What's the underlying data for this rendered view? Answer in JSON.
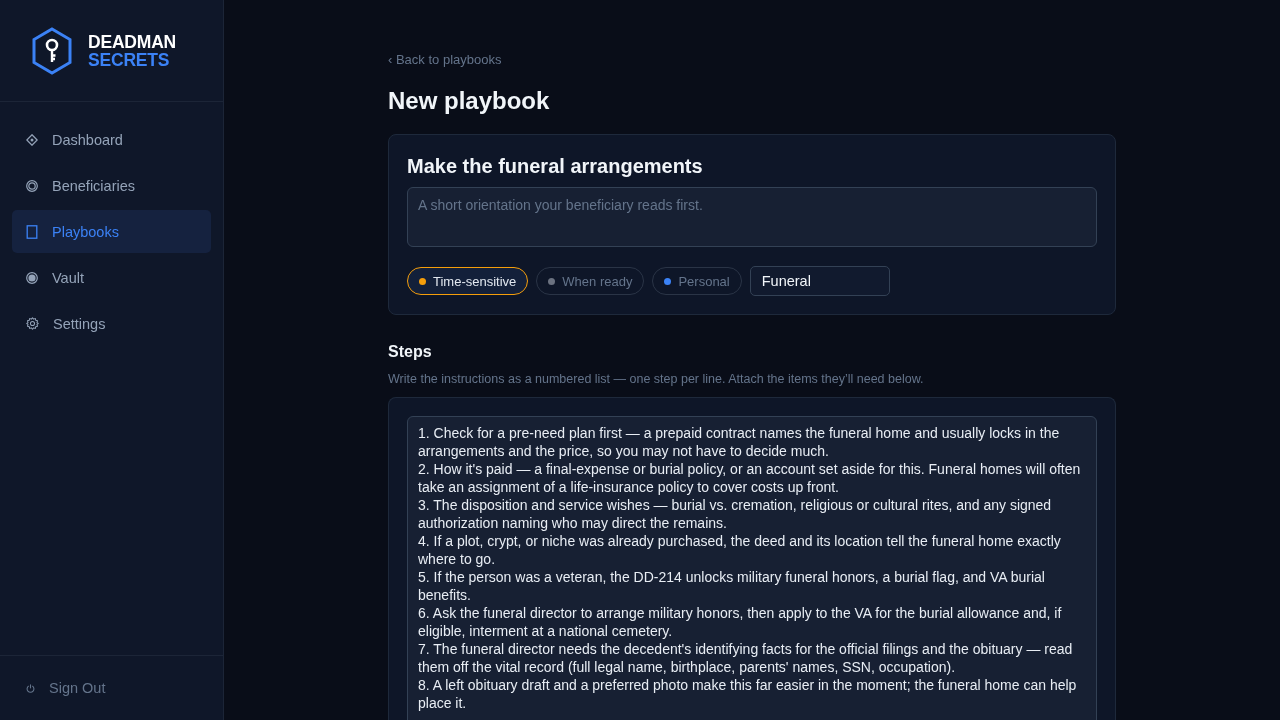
{
  "sidebar": {
    "logo": {
      "line_1": "DEADMAN",
      "line_2": "SECRETS"
    },
    "nav_items": [
      {
        "kind": "dashboard",
        "label": "Dashboard",
        "selected": false
      },
      {
        "kind": "beneficiaries",
        "label": "Beneficiaries",
        "selected": false
      },
      {
        "kind": "playbooks",
        "label": "Playbooks",
        "selected": true
      },
      {
        "kind": "vault",
        "label": "Vault",
        "selected": false
      },
      {
        "kind": "settings",
        "label": "Settings",
        "selected": false
      }
    ],
    "footer": {
      "label": "Sign Out"
    }
  },
  "back_link": "‹ Back to playbooks",
  "page_title": "New playbook",
  "playbook_card": {
    "title": "Make the funeral arrangements",
    "summary": {
      "placeholder": "A short orientation your beneficiary reads first."
    },
    "priorities": [
      {
        "label": "Time-sensitive",
        "color": "#f59e0b",
        "selected": true
      },
      {
        "label": "When ready",
        "color": "#6b7280",
        "selected": false
      },
      {
        "label": "Personal",
        "color": "#3b82f6",
        "selected": false
      }
    ],
    "category": {
      "value": "Funeral"
    }
  },
  "steps_section": {
    "heading": "Steps",
    "hint": "Write the instructions as a numbered list — one step per line. Attach the items they’ll need below.",
    "steps": [
      "1. Check for a pre-need plan first — a prepaid contract names the funeral home and usually locks in the arrangements and the price, so you may not have to decide much.",
      "2. How it's paid — a final-expense or burial policy, or an account set aside for this. Funeral homes will often take an assignment of a life-insurance policy to cover costs up front.",
      "3. The disposition and service wishes — burial vs. cremation, religious or cultural rites, and any signed authorization naming who may direct the remains.",
      "4. If a plot, crypt, or niche was already purchased, the deed and its location tell the funeral home exactly where to go.",
      "5. If the person was a veteran, the DD-214 unlocks military funeral honors, a burial flag, and VA burial benefits.",
      "6. Ask the funeral director to arrange military honors, then apply to the VA for the burial allowance and, if eligible, interment at a national cemetery.",
      "7. The funeral director needs the decedent's identifying facts for the official filings and the obituary — read them off the vital record (full legal name, birthplace, parents' names, SSN, occupation).",
      "8. A left obituary draft and a preferred photo make this far easier in the moment; the funeral home can help place it."
    ]
  }
}
